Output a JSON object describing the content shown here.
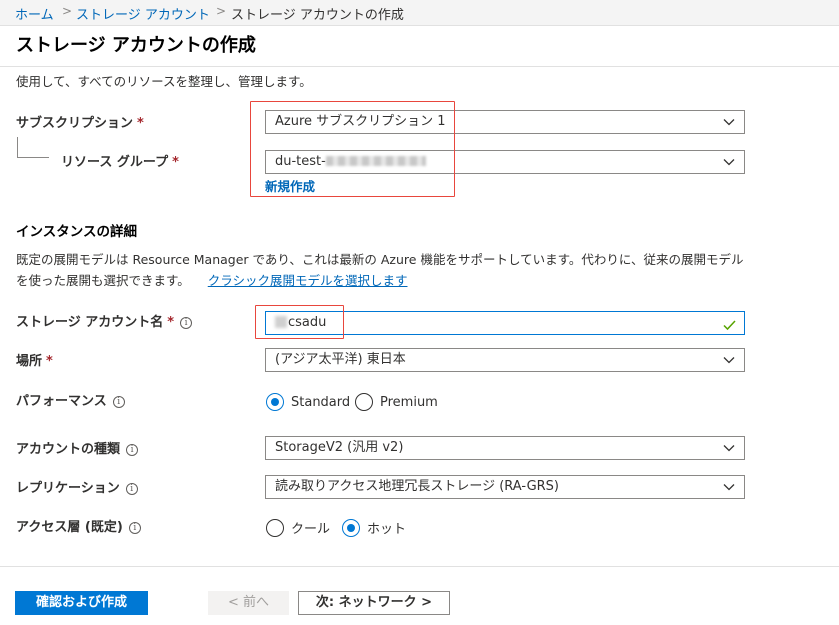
{
  "breadcrumb": {
    "items": [
      "ホーム",
      "ストレージ アカウント",
      "ストレージ アカウントの作成"
    ],
    "separator": ">"
  },
  "page": {
    "title": "ストレージ アカウントの作成",
    "intro": "使用して、すべてのリソースを整理し、管理します。"
  },
  "project": {
    "subscription_label": "サブスクリプション",
    "subscription_value": "Azure サブスクリプション 1",
    "resource_group_label": "リソース グループ",
    "resource_group_value_prefix": "du-test-",
    "create_new_link": "新規作成"
  },
  "instance": {
    "section_title": "インスタンスの詳細",
    "description": "既定の展開モデルは Resource Manager であり、これは最新の Azure 機能をサポートしています。代わりに、従来の展開モデルを使った展開も選択できます。",
    "classic_link": "クラシック展開モデルを選択します",
    "account_name_label": "ストレージ アカウント名",
    "account_name_value": "csadu",
    "location_label": "場所",
    "location_value": "(アジア太平洋) 東日本",
    "performance_label": "パフォーマンス",
    "performance_options": [
      "Standard",
      "Premium"
    ],
    "performance_selected": "Standard",
    "account_kind_label": "アカウントの種類",
    "account_kind_value": "StorageV2 (汎用 v2)",
    "replication_label": "レプリケーション",
    "replication_value": "読み取りアクセス地理冗長ストレージ (RA-GRS)",
    "access_tier_label": "アクセス層 (既定)",
    "access_tier_options": [
      "クール",
      "ホット"
    ],
    "access_tier_selected": "ホット"
  },
  "required_mark": "*",
  "info_glyph": "i",
  "footer": {
    "review_create": "確認および作成",
    "previous": "< 前へ",
    "next": "次: ネットワーク >"
  },
  "colors": {
    "accent": "#0078d4",
    "link": "#0067b8",
    "required": "#a4262c",
    "highlight": "#e8463d",
    "valid_check": "#57a300"
  },
  "icons": {
    "dropdown": "chevron-down-icon",
    "info": "info-icon",
    "valid": "checkmark-icon"
  }
}
